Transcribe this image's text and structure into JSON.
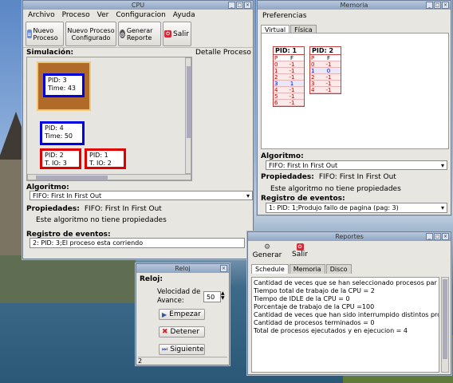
{
  "cpu": {
    "title": "CPU",
    "menu": [
      "Archivo",
      "Proceso",
      "Ver",
      "Configuracion",
      "Ayuda"
    ],
    "toolbar": {
      "nuevo": "Nuevo Proceso",
      "configurado": "Nuevo Proceso Configurado",
      "generar": "Generar Reporte",
      "salir": "Salir"
    },
    "simulacion_label": "Simulación:",
    "detalle_label": "Detalle Proceso",
    "procs": [
      {
        "pid": "PID: 3",
        "info": "Time: 43"
      },
      {
        "pid": "PID: 4",
        "info": "Time: 50"
      },
      {
        "pid": "PID: 2",
        "info": "T. IO: 3"
      },
      {
        "pid": "PID: 1",
        "info": "T. IO: 2"
      }
    ],
    "algoritmo_label": "Algoritmo:",
    "algoritmo_value": "FIFO: First In First Out",
    "propiedades_label": "Propiedades:",
    "propiedades_value": "FIFO: First In First Out",
    "no_props": "Este algoritmo no tiene propiedades",
    "registro_label": "Registro de eventos:",
    "registro_value": "2: PID: 3;El proceso esta corriendo"
  },
  "memoria": {
    "title": "Memoria",
    "menu": [
      "Preferencias"
    ],
    "tabs": [
      "Virtual",
      "Física"
    ],
    "pid1": {
      "title": "PID: 1",
      "p": "P",
      "f": "F",
      "rows": [
        [
          "0",
          "-1"
        ],
        [
          "1",
          "-1"
        ],
        [
          "2",
          "-1"
        ],
        [
          "3",
          "1"
        ],
        [
          "4",
          "-1"
        ],
        [
          "5",
          "-1"
        ],
        [
          "6",
          "-1"
        ]
      ]
    },
    "pid2": {
      "title": "PID: 2",
      "p": "P",
      "f": "F",
      "rows": [
        [
          "0",
          "-1"
        ],
        [
          "1",
          "0"
        ],
        [
          "2",
          "-1"
        ],
        [
          "3",
          "-1"
        ],
        [
          "4",
          "-1"
        ]
      ]
    },
    "algoritmo_label": "Algoritmo:",
    "algoritmo_value": "FIFO: First In First Out",
    "propiedades_label": "Propiedades:",
    "propiedades_value": "FIFO: First In First Out",
    "no_props": "Este algoritmo no tiene propiedades",
    "registro_label": "Registro de eventos:",
    "registro_value": "1: PID: 1;Produjo fallo de pagina (pag: 3)"
  },
  "reloj": {
    "title": "Reloj",
    "label": "Reloj:",
    "velocidad": "Velocidad de Avance:",
    "velocidad_value": "50",
    "empezar": "Empezar",
    "detener": "Detener",
    "siguiente": "Siguiente",
    "status": "2"
  },
  "reportes": {
    "title": "Reportes",
    "generar": "Generar",
    "salir": "Salir",
    "tabs": [
      "Schedule",
      "Memoria",
      "Disco"
    ],
    "lines": [
      "Cantidad de veces que se han seleccionado procesos par",
      "Tiempo total de trabajo de la CPU = 2",
      "Tiempo de IDLE de la CPU = 0",
      "Porcentaje de trabajo de la CPU =100",
      "Cantidad de veces que han sido interrumpido distintos pro",
      "Cantidad de procesos terminados = 0",
      "Total de procesos ejecutados y en ejecucion = 4"
    ]
  }
}
